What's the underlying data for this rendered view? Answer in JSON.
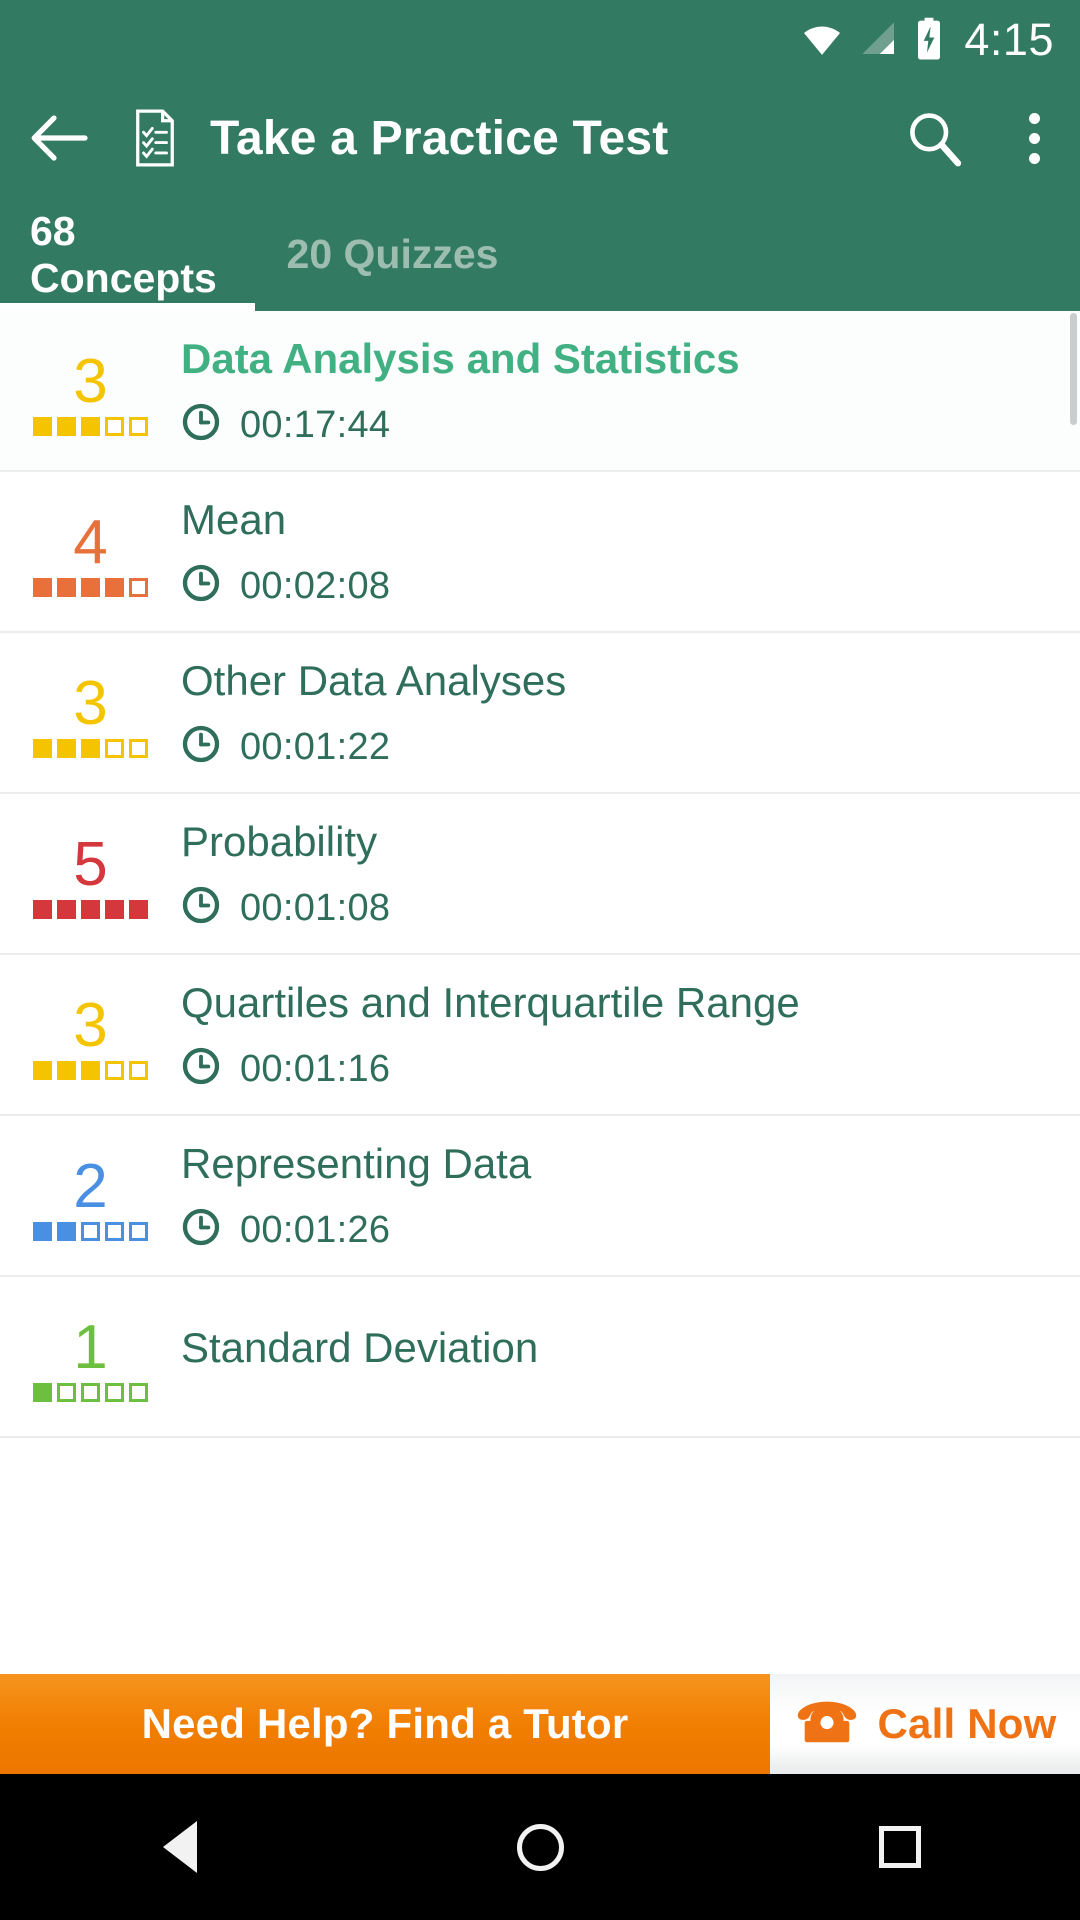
{
  "status_bar": {
    "time": "4:15",
    "icons": [
      "wifi-icon",
      "cellular-signal-icon",
      "battery-charging-icon"
    ]
  },
  "app_bar": {
    "back_icon": "back-arrow-icon",
    "leading_icon": "practice-test-document-icon",
    "title": "Take a Practice Test",
    "search_icon": "search-icon",
    "overflow_icon": "more-options-icon",
    "background_color": "#337a63"
  },
  "tabs": [
    {
      "label": "68 Concepts",
      "active": true
    },
    {
      "label": "20 Quizzes",
      "active": false
    }
  ],
  "colors": {
    "brand_green": "#337a63",
    "title_green": "#2f6e5b",
    "accent_green": "#41b083",
    "score_yellow": "#f5c400",
    "score_orange": "#e8703a",
    "score_red": "#d4373c",
    "score_blue": "#4a90e2",
    "score_lime": "#6cbf3f",
    "banner_orange": "#f07d00",
    "inactive_tab": "#9dbdb1"
  },
  "list": [
    {
      "score": "3",
      "filled": 3,
      "total": 5,
      "color": "#f5c400",
      "title": "Data Analysis and Statistics",
      "time": "00:17:44",
      "clock_icon": "clock-icon",
      "selected": true
    },
    {
      "score": "4",
      "filled": 4,
      "total": 5,
      "color": "#e8703a",
      "title": "Mean",
      "time": "00:02:08",
      "clock_icon": "clock-icon",
      "selected": false
    },
    {
      "score": "3",
      "filled": 3,
      "total": 5,
      "color": "#f5c400",
      "title": "Other Data Analyses",
      "time": "00:01:22",
      "clock_icon": "clock-icon",
      "selected": false
    },
    {
      "score": "5",
      "filled": 5,
      "total": 5,
      "color": "#d4373c",
      "title": "Probability",
      "time": "00:01:08",
      "clock_icon": "clock-icon",
      "selected": false
    },
    {
      "score": "3",
      "filled": 3,
      "total": 5,
      "color": "#f5c400",
      "title": "Quartiles and Interquartile Range",
      "time": "00:01:16",
      "clock_icon": "clock-icon",
      "selected": false
    },
    {
      "score": "2",
      "filled": 2,
      "total": 5,
      "color": "#4a90e2",
      "title": "Representing Data",
      "time": "00:01:26",
      "clock_icon": "clock-icon",
      "selected": false
    },
    {
      "score": "1",
      "filled": 1,
      "total": 5,
      "color": "#6cbf3f",
      "title": "Standard Deviation",
      "time": "",
      "clock_icon": "clock-icon",
      "selected": false
    }
  ],
  "banner": {
    "left_label": "Need Help? Find a Tutor",
    "right_label": "Call Now",
    "phone_icon": "telephone-icon"
  },
  "nav_bar": {
    "back_icon": "android-back-icon",
    "home_icon": "android-home-icon",
    "recents_icon": "android-recents-icon"
  }
}
